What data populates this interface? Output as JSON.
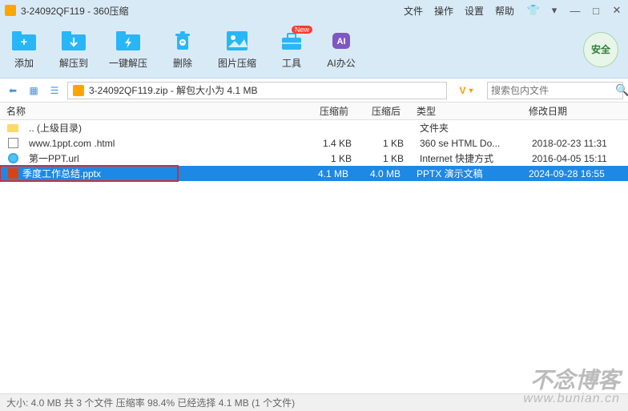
{
  "window": {
    "title": "3-24092QF119 - 360压缩"
  },
  "menus": {
    "file": "文件",
    "operate": "操作",
    "settings": "设置",
    "help": "帮助"
  },
  "toolbar": {
    "add": "添加",
    "extract_to": "解压到",
    "one_click": "一键解压",
    "delete": "删除",
    "img_compress": "图片压缩",
    "tools": "工具",
    "ai_office": "AI办公",
    "new_badge": "New",
    "safe": "安全"
  },
  "pathbar": {
    "breadcrumb": "3-24092QF119.zip - 解包大小为 4.1 MB",
    "v_label": "V",
    "search_placeholder": "搜索包内文件"
  },
  "headers": {
    "name": "名称",
    "before": "压缩前",
    "after": "压缩后",
    "type": "类型",
    "date": "修改日期"
  },
  "rows": [
    {
      "name": ".. (上级目录)",
      "before": "",
      "after": "",
      "type": "文件夹",
      "date": "",
      "icon": "folder"
    },
    {
      "name": "www.1ppt.com .html",
      "before": "1.4 KB",
      "after": "1 KB",
      "type": "360 se HTML Do...",
      "date": "2018-02-23 11:31",
      "icon": "html"
    },
    {
      "name": "第一PPT.url",
      "before": "1 KB",
      "after": "1 KB",
      "type": "Internet 快捷方式",
      "date": "2016-04-05 15:11",
      "icon": "url"
    },
    {
      "name": "季度工作总结.pptx",
      "before": "4.1 MB",
      "after": "4.0 MB",
      "type": "PPTX 演示文稿",
      "date": "2024-09-28 16:55",
      "icon": "pptx",
      "selected": true
    }
  ],
  "status": "大小: 4.0 MB 共 3 个文件 压缩率 98.4% 已经选择 4.1 MB (1 个文件)",
  "watermark": {
    "line1": "不念博客",
    "line2": "www.bunian.cn"
  }
}
